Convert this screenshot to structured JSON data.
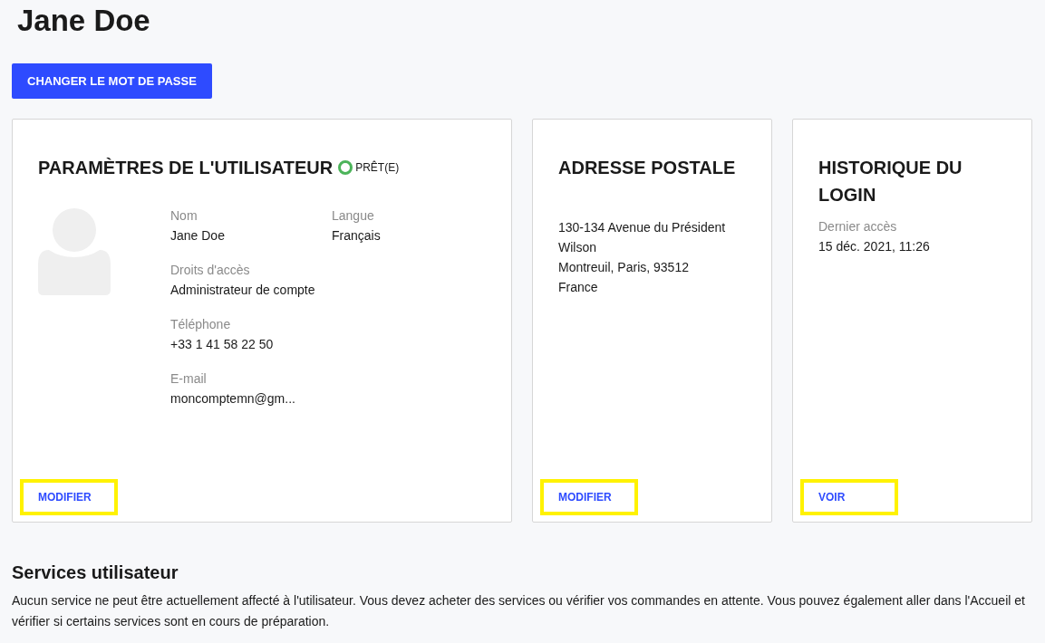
{
  "title": "Jane Doe",
  "change_password_button": "CHANGER LE MOT DE PASSE",
  "cards": [
    {
      "kind": "user",
      "title": "PARAMÈTRES DE L'UTILISATEUR",
      "status": {
        "label": "PRÊT(E)",
        "color": "#4cb45a"
      },
      "fields": [
        {
          "label": "Nom",
          "value": "Jane Doe"
        },
        {
          "label": "Langue",
          "value": "Français"
        },
        {
          "label": "Droits d'accès",
          "value": "Administrateur de compte"
        },
        {
          "label": "Téléphone",
          "value": "+33 1 41 58 22 50"
        },
        {
          "label": "E-mail",
          "value": "moncomptemn@gm..."
        }
      ],
      "action": {
        "label": "MODIFIER",
        "highlighted": true
      }
    },
    {
      "kind": "address",
      "title": "ADRESSE POSTALE",
      "lines": [
        "130-134 Avenue du Président Wilson",
        "Montreuil, Paris, 93512",
        "France"
      ],
      "action": {
        "label": "MODIFIER",
        "highlighted": true
      }
    },
    {
      "kind": "login",
      "title": "HISTORIQUE DU LOGIN",
      "fields": [
        {
          "label": "Dernier accès",
          "value": "15 déc. 2021, 11:26"
        }
      ],
      "action": {
        "label": "VOIR",
        "highlighted": true
      }
    }
  ],
  "services": {
    "title": "Services utilisateur",
    "text": "Aucun service ne peut être actuellement affecté à l'utilisateur. Vous devez acheter des services ou vérifier vos commandes en attente. Vous pouvez également aller dans l'Accueil et vérifier si certains services sont en cours de préparation."
  }
}
